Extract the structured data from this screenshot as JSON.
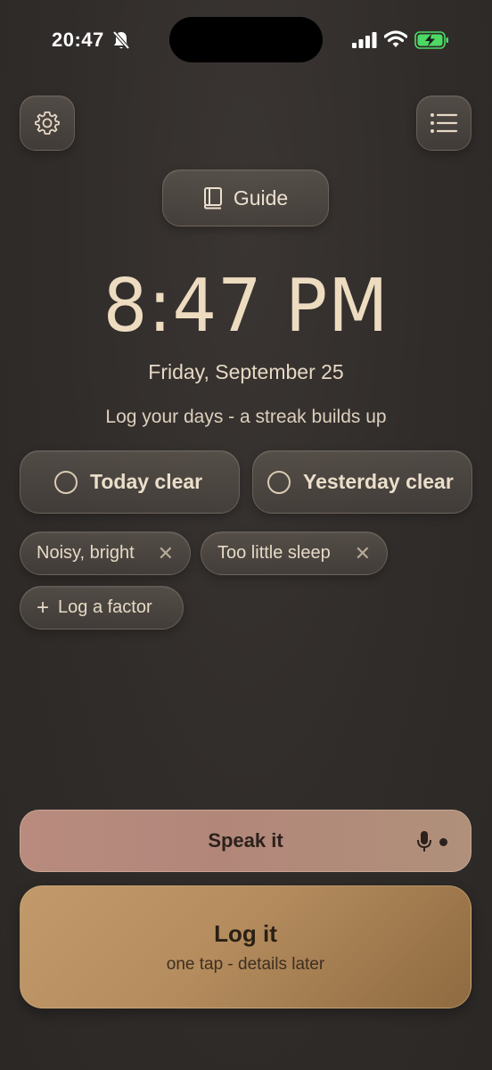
{
  "status": {
    "time": "20:47"
  },
  "guide": {
    "label": "Guide"
  },
  "clock": {
    "time": "8:47 PM",
    "date": "Friday, September 25"
  },
  "tagline": "Log your days - a streak builds up",
  "clear": {
    "today": "Today clear",
    "yesterday": "Yesterday clear"
  },
  "factors": [
    {
      "label": "Noisy, bright",
      "remove": "✕"
    },
    {
      "label": "Too little sleep",
      "remove": "✕"
    }
  ],
  "add_factor": {
    "plus": "+",
    "label": "Log a factor"
  },
  "speak": {
    "label": "Speak it"
  },
  "log": {
    "title": "Log it",
    "subtitle": "one tap - details later"
  },
  "colors": {
    "accent_gold": "#b48c5e",
    "accent_rose": "#b88b7e",
    "battery_green": "#4cd964"
  },
  "icons": [
    "bell-off-icon",
    "signal-icon",
    "wifi-icon",
    "battery-charging-icon",
    "gear-icon",
    "list-icon",
    "book-icon",
    "microphone-icon"
  ]
}
